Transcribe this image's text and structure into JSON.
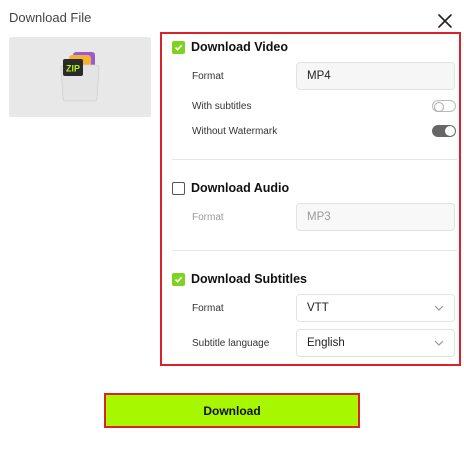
{
  "dialog": {
    "title": "Download File",
    "close_icon": "close-icon"
  },
  "thumbnail": {
    "icon": "zip-file-icon",
    "badge_text": "ZIP"
  },
  "video": {
    "label": "Download Video",
    "checked": true,
    "format_label": "Format",
    "format_value": "MP4",
    "subtitles_label": "With subtitles",
    "subtitles_on": false,
    "watermark_label": "Without Watermark",
    "watermark_on": true
  },
  "audio": {
    "label": "Download Audio",
    "checked": false,
    "format_label": "Format",
    "format_value": "MP3"
  },
  "subtitles": {
    "label": "Download Subtitles",
    "checked": true,
    "format_label": "Format",
    "format_value": "VTT",
    "language_label": "Subtitle language",
    "language_value": "English"
  },
  "download_button": {
    "label": "Download"
  },
  "colors": {
    "accent_green": "#a6f700",
    "checkbox_green": "#7ed321",
    "highlight_red": "#d9232a"
  }
}
